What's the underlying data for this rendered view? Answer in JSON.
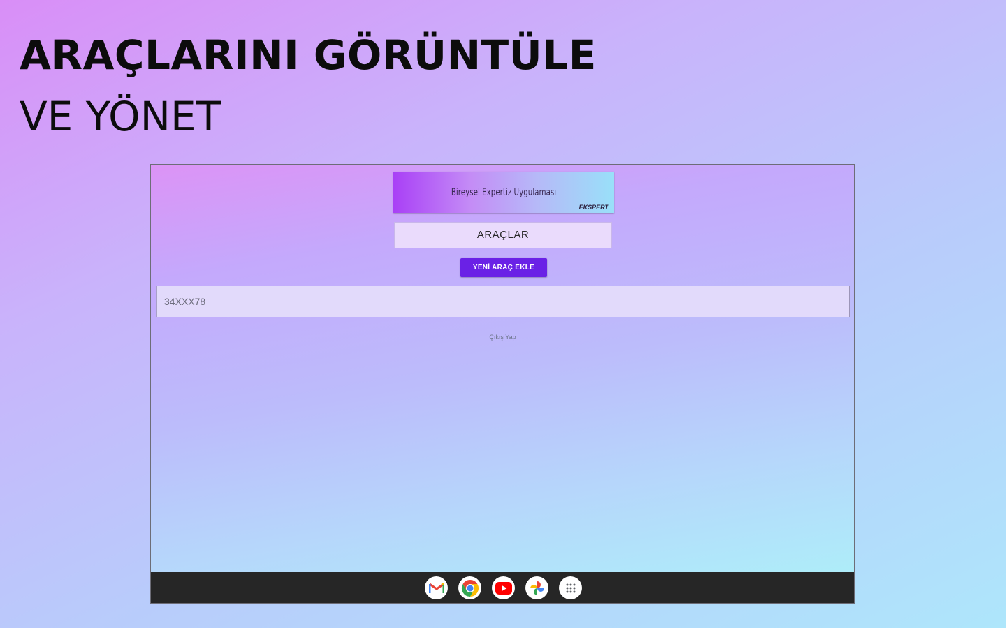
{
  "headline": {
    "line1": "ARAÇLARINI GÖRÜNTÜLE",
    "line2": "VE YÖNET"
  },
  "app": {
    "banner": {
      "title": "Bireysel Expertiz Uygulaması",
      "brand": "EKSPERT"
    },
    "section_title": "ARAÇLAR",
    "add_button_label": "YENİ ARAÇ EKLE",
    "vehicles": [
      {
        "plate": "34XXX78"
      }
    ],
    "logout_label": "Çıkış Yap"
  },
  "shelf": {
    "apps": [
      "gmail-icon",
      "chrome-icon",
      "youtube-icon",
      "photos-icon",
      "launcher-icon"
    ]
  },
  "colors": {
    "accent": "#6a21e6",
    "shelf": "#262626"
  }
}
